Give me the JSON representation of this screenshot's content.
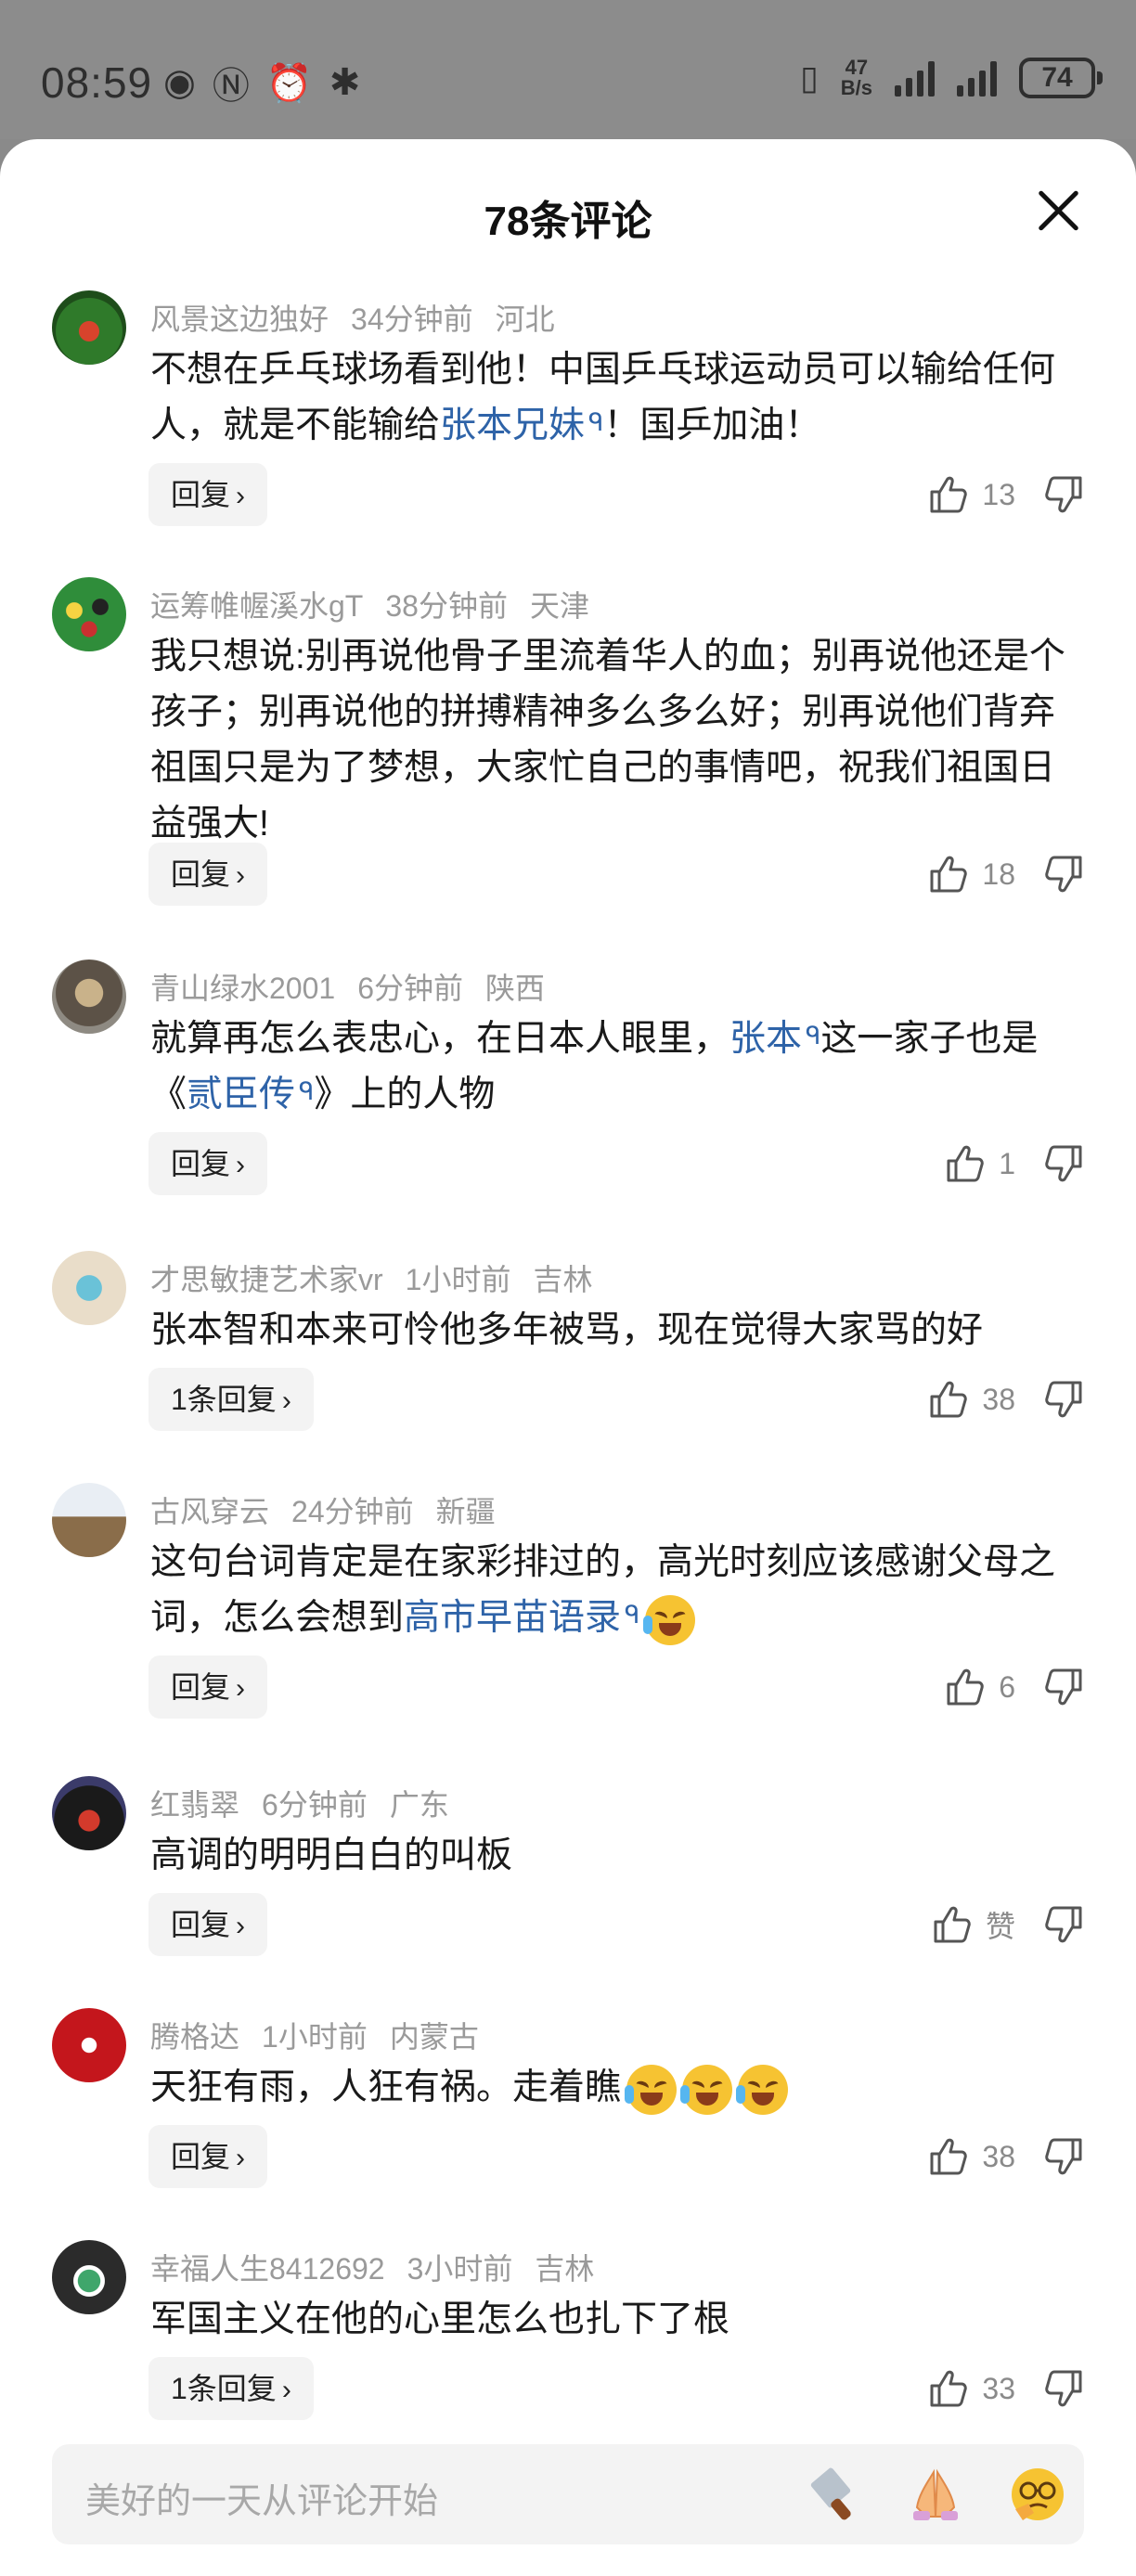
{
  "status_bar": {
    "time": "08:59",
    "net_speed_value": "47",
    "net_speed_unit": "B/s",
    "battery": "74"
  },
  "sheet": {
    "title": "78条评论"
  },
  "comments": [
    {
      "user": "风景这边独好",
      "time": "34分钟前",
      "location": "河北",
      "text_a": "不想在乒乓球场看到他！中国乒乓球运动员可以输给任何人，就是不能输给",
      "link": "张本兄妹",
      "text_b": "！国乒加油！",
      "reply": "回复",
      "likes": "13"
    },
    {
      "user": "运筹帷幄溪水gT",
      "time": "38分钟前",
      "location": "天津",
      "text": "我只想说:别再说他骨子里流着华人的血；别再说他还是个孩子；别再说他的拼搏精神多么多么好；别再说他们背弃祖国只是为了梦想，大家忙自己的事情吧，祝我们祖国日益强大!",
      "reply": "回复",
      "likes": "18"
    },
    {
      "user": "青山绿水2001",
      "time": "6分钟前",
      "location": "陕西",
      "text_a": "就算再怎么表忠心，在日本人眼里，",
      "link1": "张本",
      "text_b": "这一家子也是《",
      "link2": "贰臣传",
      "text_c": "》上的人物",
      "reply": "回复",
      "likes": "1"
    },
    {
      "user": "才思敏捷艺术家vr",
      "time": "1小时前",
      "location": "吉林",
      "text": "张本智和本来可怜他多年被骂，现在觉得大家骂的好",
      "reply": "1条回复",
      "likes": "38"
    },
    {
      "user": "古风穿云",
      "time": "24分钟前",
      "location": "新疆",
      "text_a": "这句台词肯定是在家彩排过的，高光时刻应该感谢父母之词，怎么会想到",
      "link": "高市早苗语录",
      "reply": "回复",
      "likes": "6"
    },
    {
      "user": "红翡翠",
      "time": "6分钟前",
      "location": "广东",
      "text": "高调的明明白白的叫板",
      "reply": "回复",
      "likes": "赞"
    },
    {
      "user": "腾格达",
      "time": "1小时前",
      "location": "内蒙古",
      "text": "天狂有雨，人狂有祸。走着瞧",
      "reply": "回复",
      "likes": "38"
    },
    {
      "user": "幸福人生8412692",
      "time": "3小时前",
      "location": "吉林",
      "text": "军国主义在他的心里怎么也扎下了根",
      "reply": "1条回复",
      "likes": "33"
    }
  ],
  "input": {
    "placeholder": "美好的一天从评论开始"
  },
  "icons": {
    "like": "thumbs-up-icon",
    "dislike": "thumbs-down-icon",
    "close": "close-icon",
    "search": "search-icon",
    "emoji_bar": [
      "knife-emoji",
      "pray-emoji",
      "thinking-emoji"
    ]
  },
  "colors": {
    "link": "#2e63a8",
    "meta": "#9a9a9a",
    "status_bar_bg": "#8c8c8c"
  }
}
